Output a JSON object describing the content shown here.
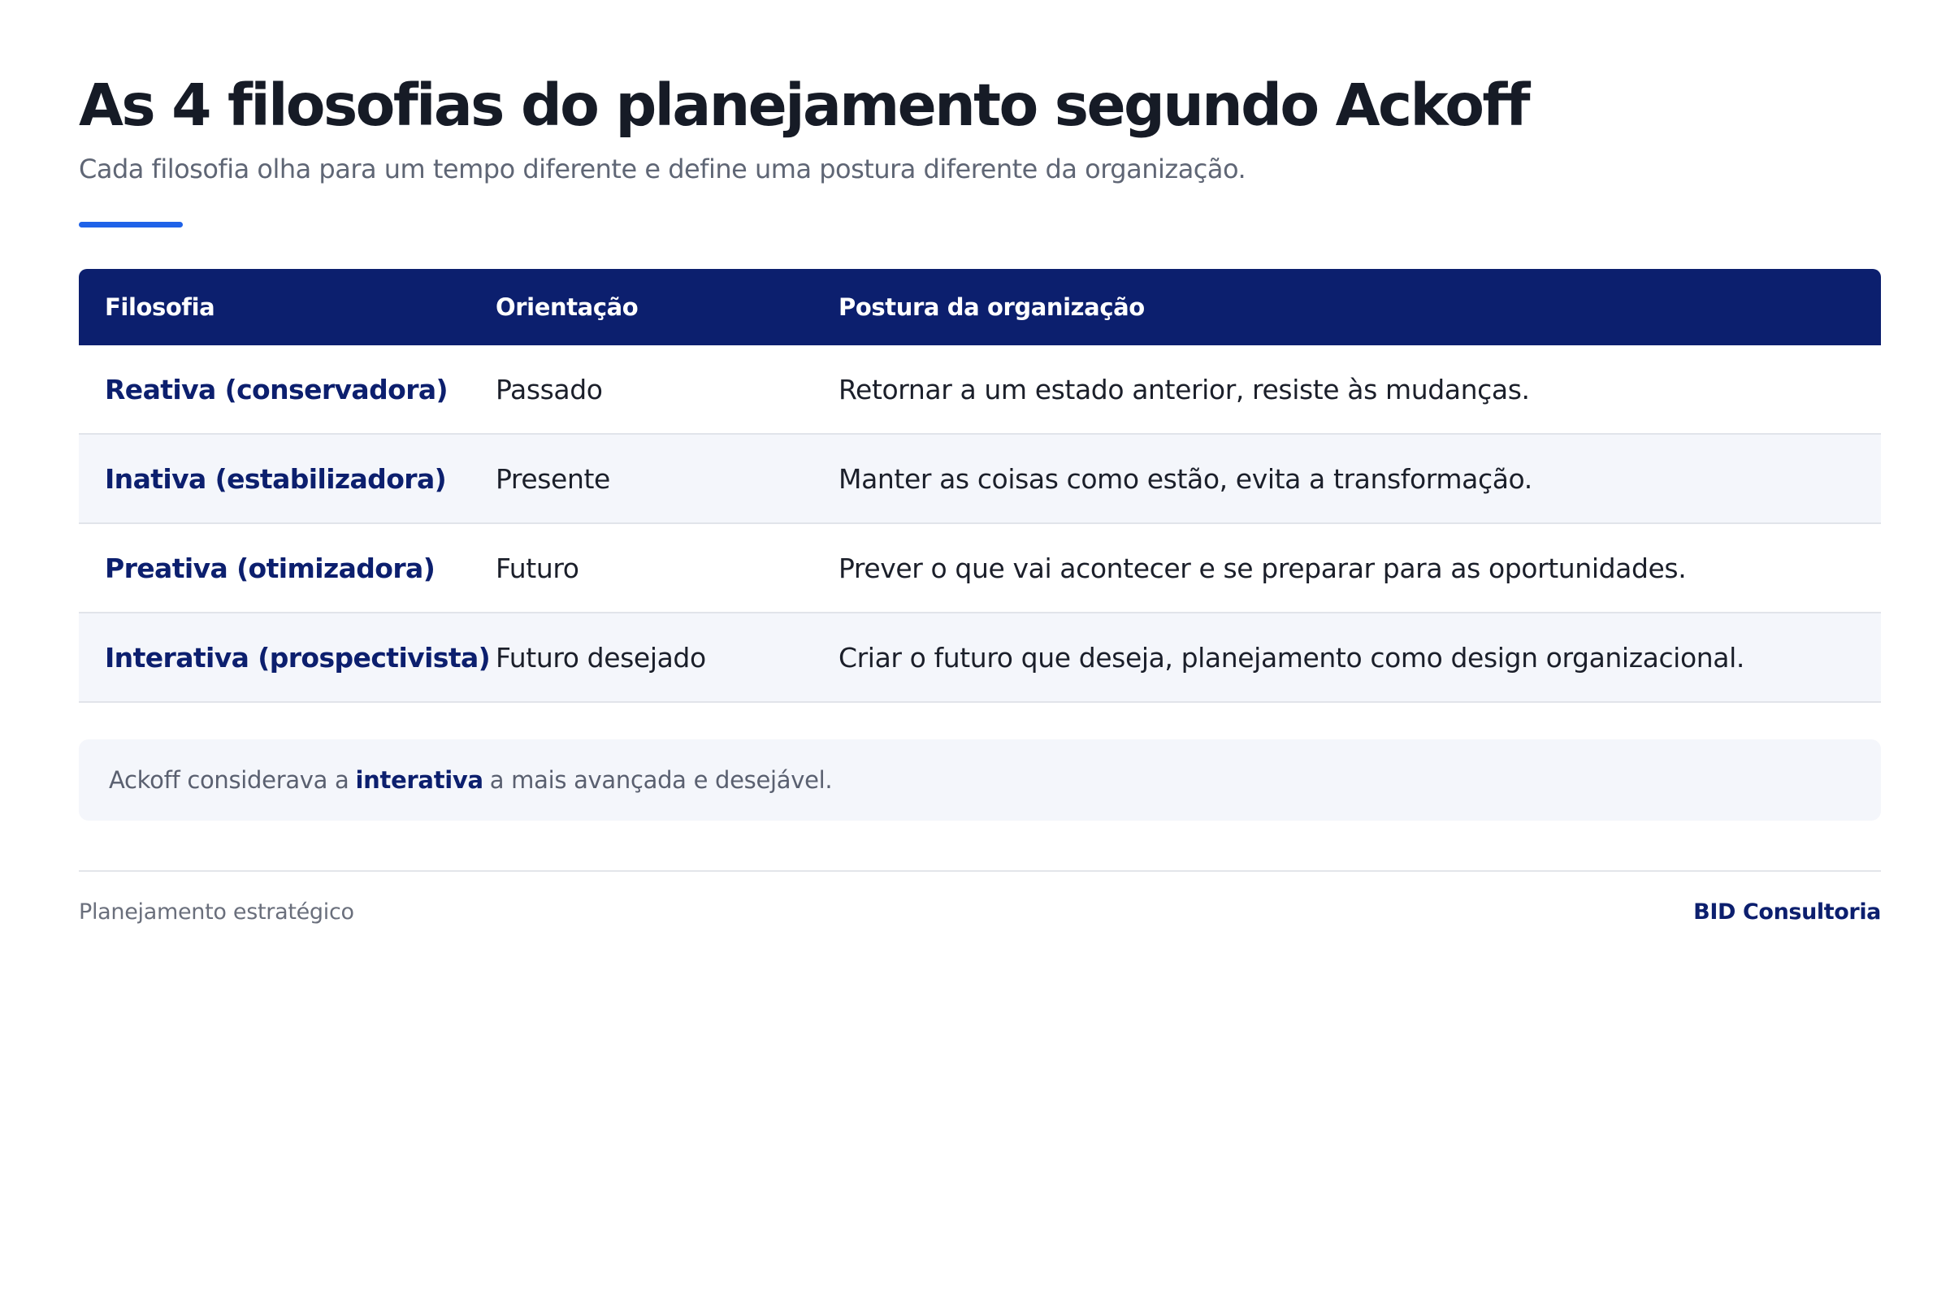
{
  "header": {
    "title": "As 4 filosofias do planejamento segundo Ackoff",
    "subtitle": "Cada filosofia olha para um tempo diferente e define uma postura diferente da organização."
  },
  "table": {
    "columns": [
      "Filosofia",
      "Orientação",
      "Postura da organização"
    ],
    "rows": [
      {
        "filosofia": "Reativa (conservadora)",
        "orientacao": "Passado",
        "postura": "Retornar a um estado anterior, resiste às mudanças."
      },
      {
        "filosofia": "Inativa (estabilizadora)",
        "orientacao": "Presente",
        "postura": "Manter as coisas como estão, evita a transformação."
      },
      {
        "filosofia": "Preativa (otimizadora)",
        "orientacao": "Futuro",
        "postura": "Prever o que vai acontecer e se preparar para as oportunidades."
      },
      {
        "filosofia": "Interativa (prospectivista)",
        "orientacao": "Futuro desejado",
        "postura": "Criar o futuro que deseja, planejamento como design organizacional."
      }
    ]
  },
  "note": {
    "prefix": "Ackoff considerava a",
    "highlight": "interativa",
    "suffix": "a mais avançada e desejável."
  },
  "footer": {
    "left": "Planejamento estratégico",
    "right": "BID Consultoria"
  },
  "colors": {
    "primary": "#0c1f6e",
    "accent": "#1f62e8",
    "row_alt": "#f4f6fb"
  }
}
